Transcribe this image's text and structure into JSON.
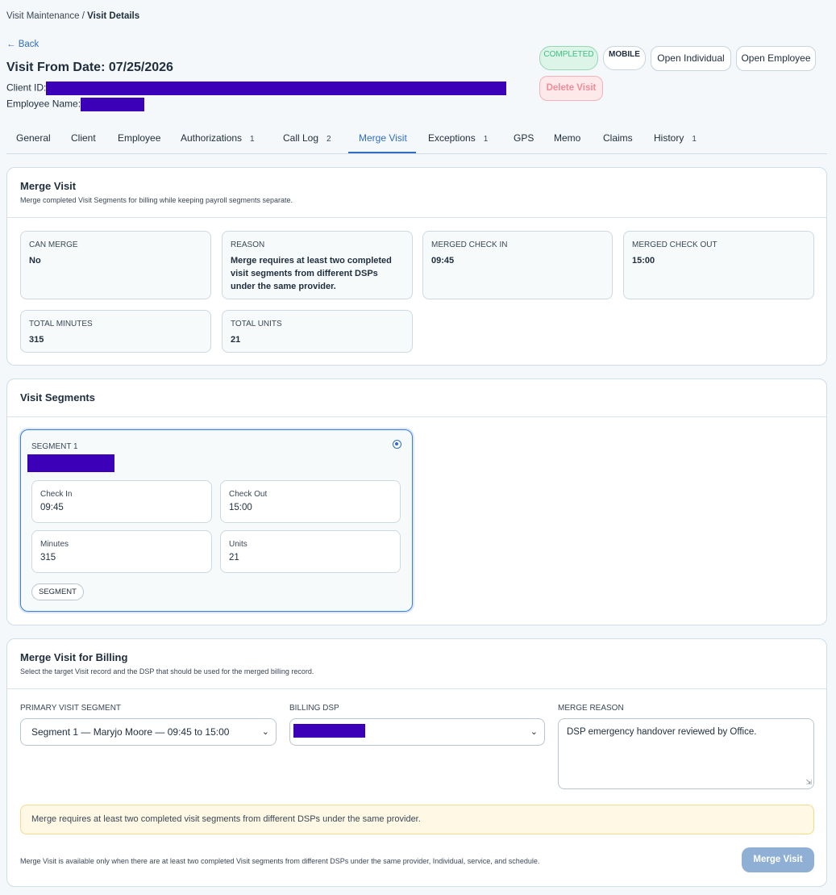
{
  "breadcrumb": {
    "parent": "Visit Maintenance / ",
    "current": "Visit Details"
  },
  "header": {
    "back_label": "← Back",
    "title": "Visit From Date: 07/25/2026",
    "client_id_label": "Client ID:",
    "employee_name_label": "Employee Name:",
    "status_badge": "COMPLETED",
    "source_badge": "MOBILE",
    "open_individual_label": "Open Individual",
    "open_employee_label": "Open Employee",
    "delete_label": "Delete Visit"
  },
  "tabs": [
    {
      "label": "General",
      "count": ""
    },
    {
      "label": "Client",
      "count": ""
    },
    {
      "label": "Employee",
      "count": ""
    },
    {
      "label": "Authorizations",
      "count": "1"
    },
    {
      "label": "Call Log",
      "count": "2"
    },
    {
      "label": "Merge Visit",
      "count": ""
    },
    {
      "label": "Exceptions",
      "count": "1"
    },
    {
      "label": "GPS",
      "count": ""
    },
    {
      "label": "Memo",
      "count": ""
    },
    {
      "label": "Claims",
      "count": ""
    },
    {
      "label": "History",
      "count": "1"
    }
  ],
  "active_tab": "Merge Visit",
  "merge_visit": {
    "title": "Merge Visit",
    "subtitle": "Merge completed Visit Segments for billing while keeping payroll segments separate.",
    "stats": [
      {
        "label": "CAN MERGE",
        "value": "No"
      },
      {
        "label": "REASON",
        "value": "Merge requires at least two completed visit segments from different DSPs under the same provider."
      },
      {
        "label": "MERGED CHECK IN",
        "value": "09:45"
      },
      {
        "label": "MERGED CHECK OUT",
        "value": "15:00"
      },
      {
        "label": "TOTAL MINUTES",
        "value": "315"
      },
      {
        "label": "TOTAL UNITS",
        "value": "21"
      }
    ]
  },
  "visit_segments": {
    "title": "Visit Segments",
    "segments": [
      {
        "label": "SEGMENT 1",
        "selected": true,
        "check_in_label": "Check In",
        "check_in": "09:45",
        "check_out_label": "Check Out",
        "check_out": "15:00",
        "minutes_label": "Minutes",
        "minutes": "315",
        "units_label": "Units",
        "units": "21",
        "tag": "SEGMENT"
      }
    ]
  },
  "billing": {
    "title": "Merge Visit for Billing",
    "subtitle": "Select the target Visit record and the DSP that should be used for the merged billing record.",
    "primary_label": "PRIMARY VISIT SEGMENT",
    "primary_value": "Segment 1 — Maryjo Moore — 09:45 to 15:00",
    "dsp_label": "BILLING DSP",
    "reason_label": "MERGE REASON",
    "reason_value": "DSP emergency handover reviewed by Office.",
    "warning": "Merge requires at least two completed visit segments from different DSPs under the same provider.",
    "footnote": "Merge Visit is available only when there are at least two completed Visit segments from different DSPs under the same provider, Individual, service, and schedule.",
    "merge_button": "Merge Visit"
  },
  "colors": {
    "accent": "#2f6ec0",
    "completed_badge": "#3cbf7f",
    "delete": "#ef8d99",
    "warning_bg": "#fff8e4",
    "redaction": "#3b00b8"
  }
}
